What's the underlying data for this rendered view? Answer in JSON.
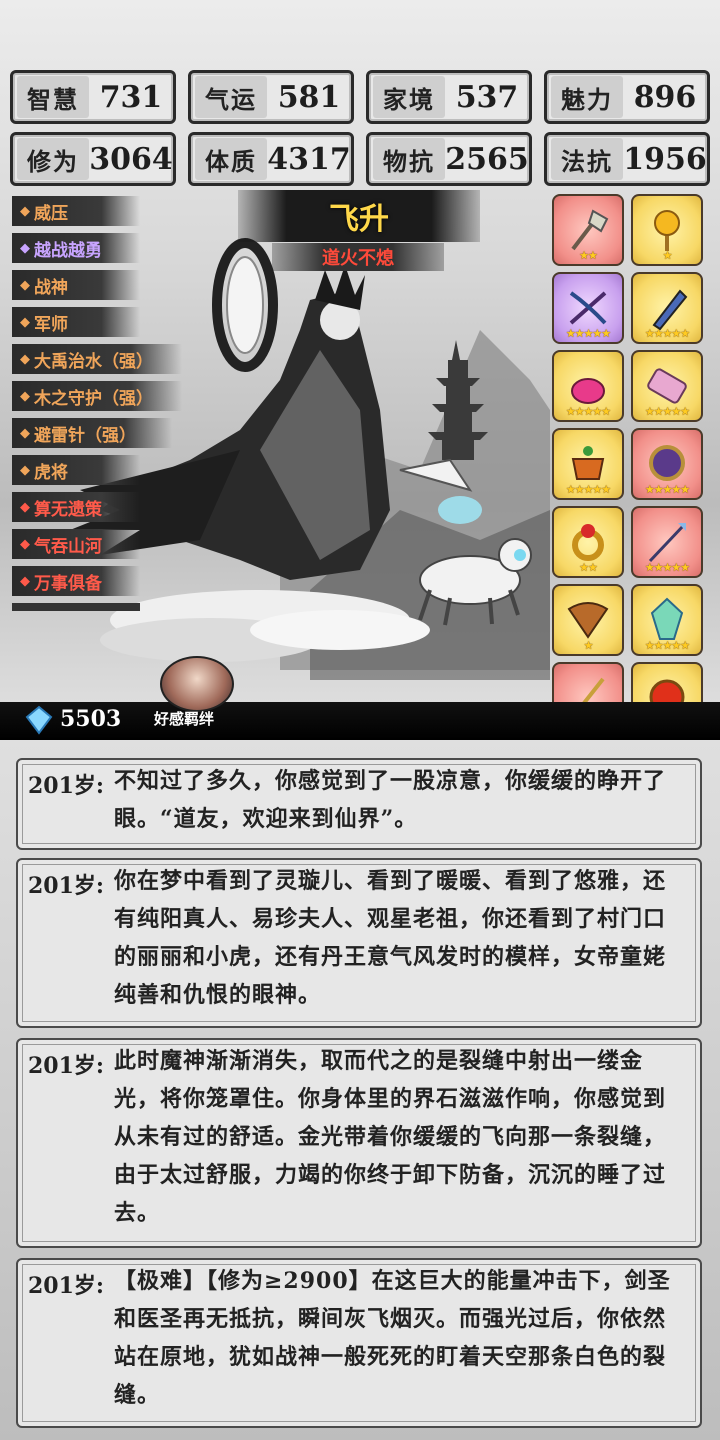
{
  "stats": [
    {
      "label": "智慧",
      "value": "731"
    },
    {
      "label": "气运",
      "value": "581"
    },
    {
      "label": "家境",
      "value": "537"
    },
    {
      "label": "魅力",
      "value": "896"
    },
    {
      "label": "修为",
      "value": "3064"
    },
    {
      "label": "体质",
      "value": "4317"
    },
    {
      "label": "物抗",
      "value": "2565"
    },
    {
      "label": "法抗",
      "value": "1956"
    }
  ],
  "skills": [
    {
      "label": "威压",
      "color": "#f0a55a"
    },
    {
      "label": "越战越勇",
      "color": "#c8a4ff"
    },
    {
      "label": "战神",
      "color": "#f0a55a"
    },
    {
      "label": "军师",
      "color": "#f0a55a"
    },
    {
      "label": "大禹治水（强）",
      "color": "#f0a55a"
    },
    {
      "label": "木之守护（强）",
      "color": "#f0a55a"
    },
    {
      "label": "避雷针（强）",
      "color": "#f0a55a"
    },
    {
      "label": "虎将",
      "color": "#f0a55a"
    },
    {
      "label": "算无遗策",
      "color": "#ff5a4a"
    },
    {
      "label": "气吞山河",
      "color": "#ff5a4a"
    },
    {
      "label": "万事俱备",
      "color": "#ff5a4a"
    }
  ],
  "header": {
    "title": "飞升",
    "subtitle": "道火不熄"
  },
  "items": [
    {
      "icon": "axe-icon",
      "bg": "red",
      "stars": "★★"
    },
    {
      "icon": "golden-flower-icon",
      "bg": "gold",
      "stars": "★"
    },
    {
      "icon": "crossbow-icon",
      "bg": "purple",
      "stars": "★★★★★"
    },
    {
      "icon": "blade-icon",
      "bg": "gold",
      "stars": "★★★★★"
    },
    {
      "icon": "pink-vessel-icon",
      "bg": "gold",
      "stars": "★★★★★"
    },
    {
      "icon": "scroll-box-icon",
      "bg": "gold",
      "stars": "★★★★★"
    },
    {
      "icon": "incense-burner-icon",
      "bg": "gold",
      "stars": "★★★★★"
    },
    {
      "icon": "mirror-icon",
      "bg": "red",
      "stars": "★★★★★"
    },
    {
      "icon": "ring-icon",
      "bg": "gold",
      "stars": "★★"
    },
    {
      "icon": "spear-icon",
      "bg": "red",
      "stars": "★★★★★"
    },
    {
      "icon": "fan-icon",
      "bg": "gold",
      "stars": "★"
    },
    {
      "icon": "crystal-icon",
      "bg": "gold",
      "stars": "★★★★★"
    },
    {
      "icon": "sword-icon",
      "bg": "red",
      "stars": "★★★"
    },
    {
      "icon": "red-orb-icon",
      "bg": "gold",
      "stars": "★"
    }
  ],
  "footer": {
    "gems": "5503",
    "favor_label": "好感羁绊"
  },
  "events": [
    {
      "age": "201岁:",
      "text": "不知过了多久，你感觉到了一股凉意，你缓缓的睁开了眼。“道友，欢迎来到仙界”。"
    },
    {
      "age": "201岁:",
      "text": "你在梦中看到了灵璇儿、看到了暖暖、看到了悠雅，还有纯阳真人、易珍夫人、观星老祖，你还看到了村门口的丽丽和小虎，还有丹王意气风发时的模样，女帝童姥纯善和仇恨的眼神。"
    },
    {
      "age": "201岁:",
      "text": "此时魔神渐渐消失，取而代之的是裂缝中射出一缕金光，将你笼罩住。你身体里的界石滋滋作响，你感觉到从未有过的舒适。金光带着你缓缓的飞向那一条裂缝，由于太过舒服，力竭的你终于卸下防备，沉沉的睡了过去。"
    },
    {
      "age": "201岁:",
      "text": "【极难】【修为≥2900】在这巨大的能量冲击下，剑圣和医圣再无抵抗，瞬间灰飞烟灭。而强光过后，你依然站在原地，犹如战神一般死死的盯着天空那条白色的裂缝。"
    }
  ]
}
